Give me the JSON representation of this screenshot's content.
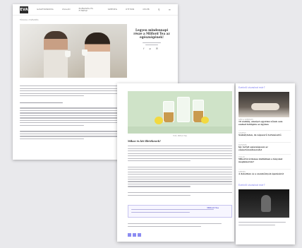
{
  "back_page": {
    "logo": "EVA",
    "nav": [
      "GASZTRONÓMIA",
      "CSALÁD",
      "EGÉSZSÉG ÉS FITNESZ",
      "SZÉPSÉG",
      "OTTHON",
      "CELEB"
    ],
    "breadcrumb": "FŐOLDAL / EGÉSZSÉG",
    "title": "Legyen mindennapi része a Milford Tea az egészségének!",
    "share_icons": "f  p  ✉"
  },
  "front_page": {
    "caption": "Fotó: Milford Tea",
    "heading": "Mikor és kit illetékesek?",
    "box_text": "Milford Tea",
    "icons": [
      "facebook-icon",
      "twitter-icon",
      "pinterest-icon"
    ]
  },
  "sidebar": {
    "section_title_1": "Ezekről olvastad már?",
    "section_title_2": "Ezekről olvastad már?",
    "items": [
      {
        "category": "SZEX & SZERELEM",
        "title": "10 szabály, amelyet egyetlen nőnek sem szabad felrúgnia az ágyban"
      },
      {
        "category": "GASZTRO",
        "title": "Szabálytalan, de népszerű tortakészítő"
      },
      {
        "category": "EGÉSZSÉG",
        "title": "Így tartsd egészségesen az emésztőrendszeredet"
      },
      {
        "category": "CSALÁD",
        "title": "Mikortól érdemes kisfiúdnak a lányokat megismernie?"
      },
      {
        "category": "SZÉPSÉG",
        "title": "A dekoltázs és a szemkörnyék ápolásáról"
      }
    ]
  }
}
